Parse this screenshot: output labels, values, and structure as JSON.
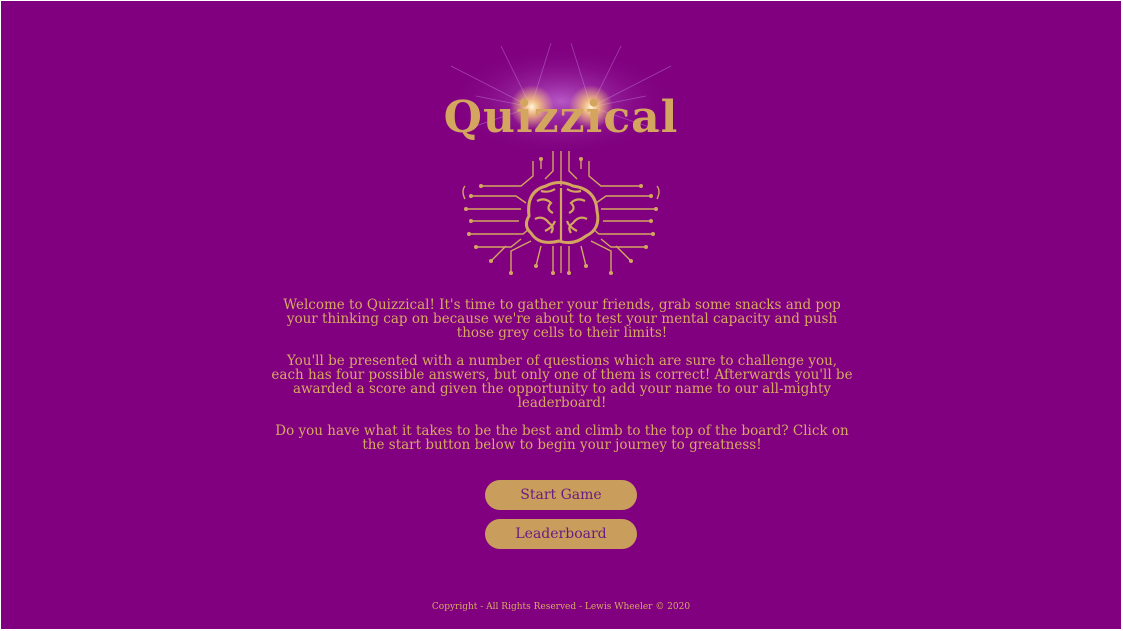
{
  "logo": {
    "title": "Quizzical",
    "icon": "glowing-circuit-brain-icon"
  },
  "intro": {
    "paragraph1": "Welcome to Quizzical! It's time to gather your friends, grab some snacks and pop your thinking cap on because we're about to test your mental capacity and push those grey cells to their limits!",
    "paragraph2": "You'll be presented with a number of questions which are sure to challenge you, each has four possible answers, but only one of them is correct! Afterwards you'll be awarded a score and given the opportunity to add your name to our all-mighty leaderboard!",
    "paragraph3": "Do you have what it takes to be the best and climb to the top of the board? Click on the start button below to begin your journey to greatness!"
  },
  "buttons": {
    "start_label": "Start Game",
    "leaderboard_label": "Leaderboard"
  },
  "footer": {
    "text": "Copyright - All Rights Reserved - Lewis Wheeler © 2020"
  },
  "colors": {
    "background": "#800080",
    "gold": "#d4a55f",
    "button": "#c99e5c",
    "button_text": "#6a1b82"
  }
}
